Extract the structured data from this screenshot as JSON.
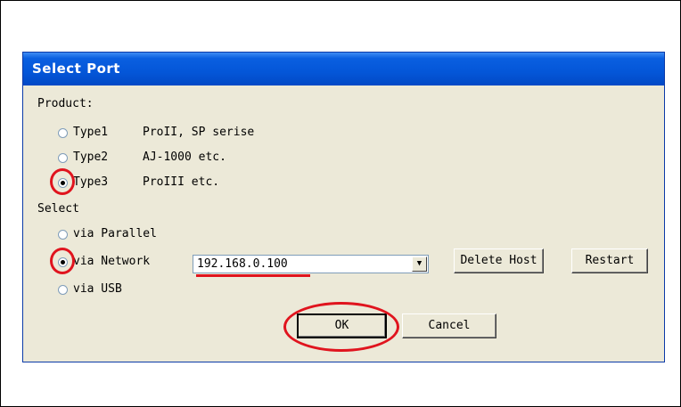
{
  "dialog": {
    "title": "Select Port",
    "product_label": "Product:",
    "types": [
      {
        "name": "Type1",
        "desc": "ProII, SP serise",
        "checked": false
      },
      {
        "name": "Type2",
        "desc": "AJ-1000 etc.",
        "checked": false
      },
      {
        "name": "Type3",
        "desc": "ProIII etc.",
        "checked": true
      }
    ],
    "select_label": "Select",
    "connections": [
      {
        "label": "via Parallel",
        "checked": false
      },
      {
        "label": "via Network",
        "checked": true
      },
      {
        "label": "via USB",
        "checked": false
      }
    ],
    "host_value": "192.168.0.100",
    "delete_host_label": "Delete Host",
    "restart_label": "Restart",
    "ok_label": "OK",
    "cancel_label": "Cancel"
  },
  "colors": {
    "titlebar": "#0456d8",
    "dialog_bg": "#ece9d8",
    "highlight": "#e0141e"
  },
  "icons": {
    "combo_arrow": "chevron-down-icon"
  }
}
